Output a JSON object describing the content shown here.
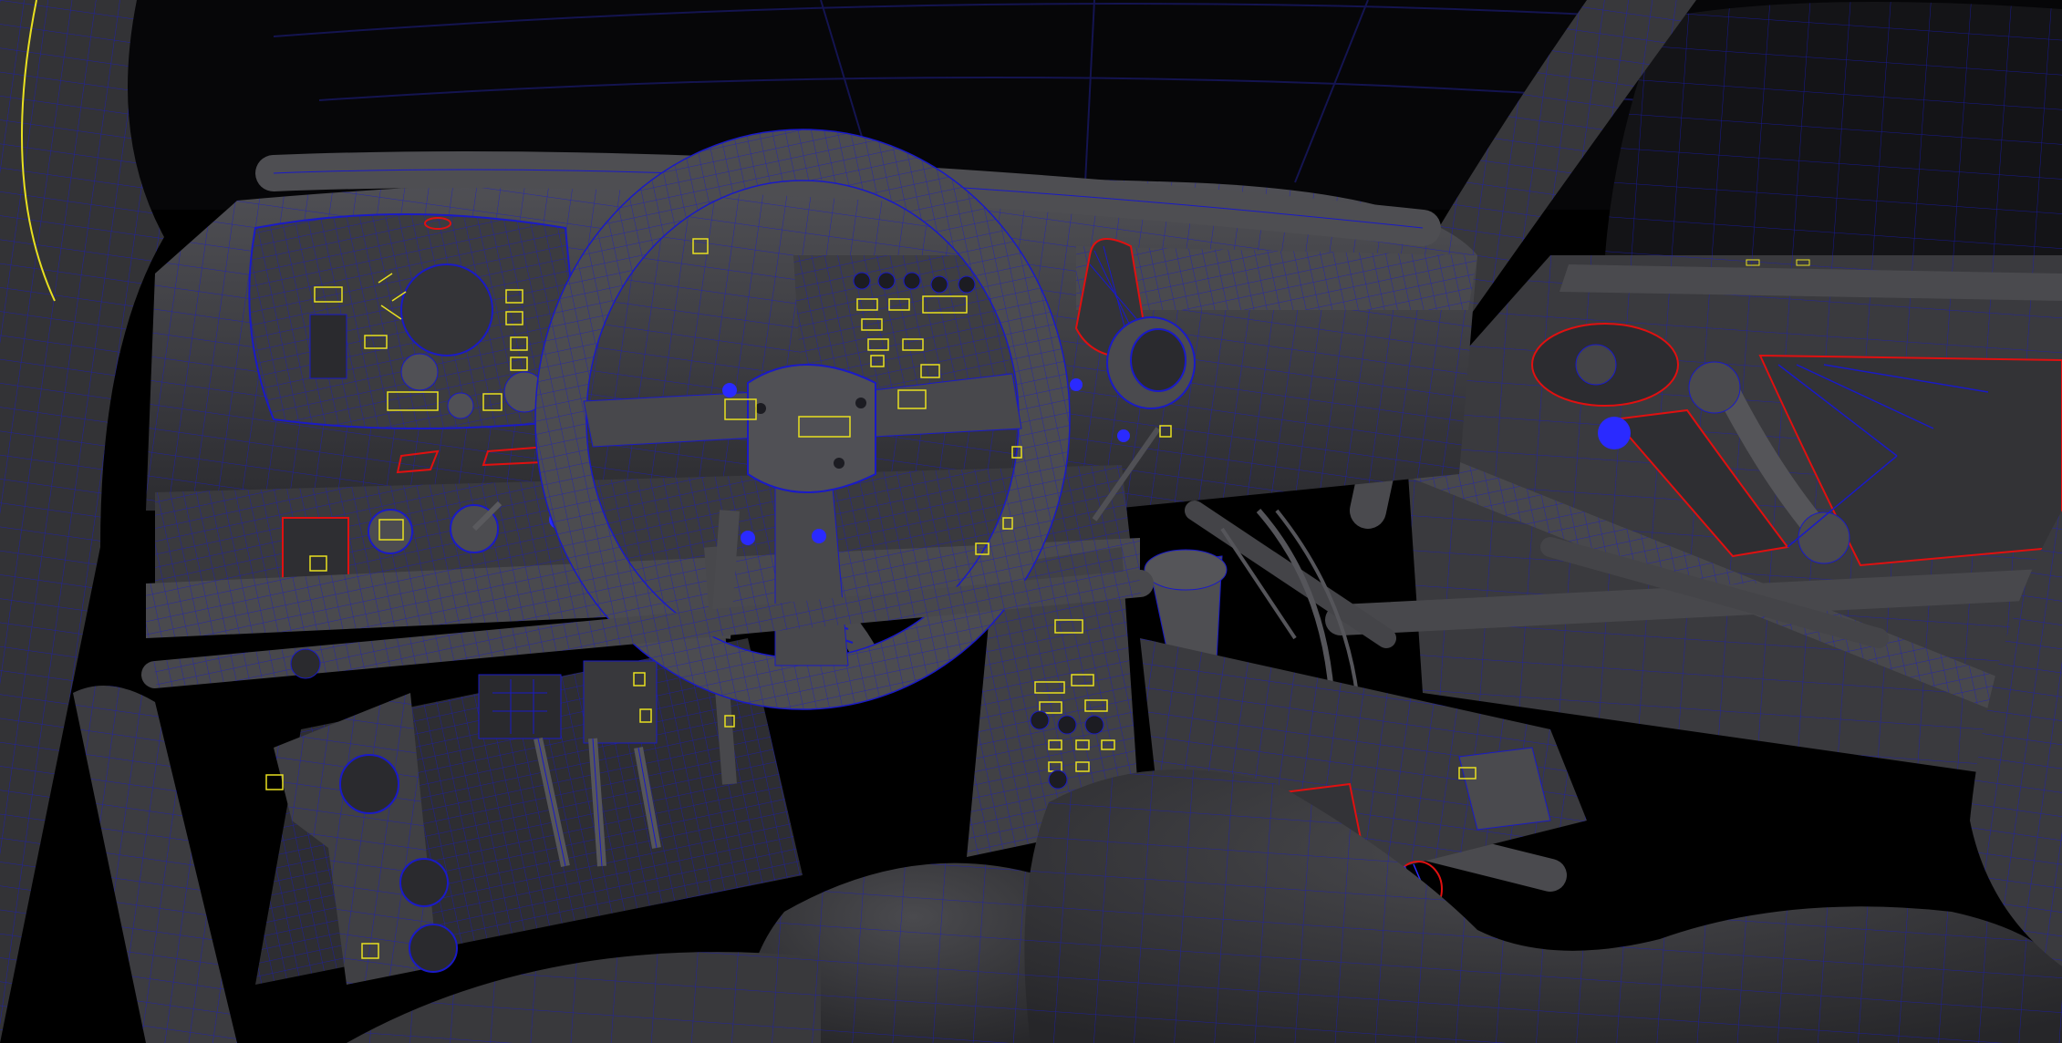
{
  "viewport": {
    "background": "#000000",
    "shade_color": "#3f3f42",
    "wire_color": "#1a1ac8",
    "select_color": "#e01010",
    "component_color": "#e8e020",
    "vertex_color": "#2a2aff"
  }
}
